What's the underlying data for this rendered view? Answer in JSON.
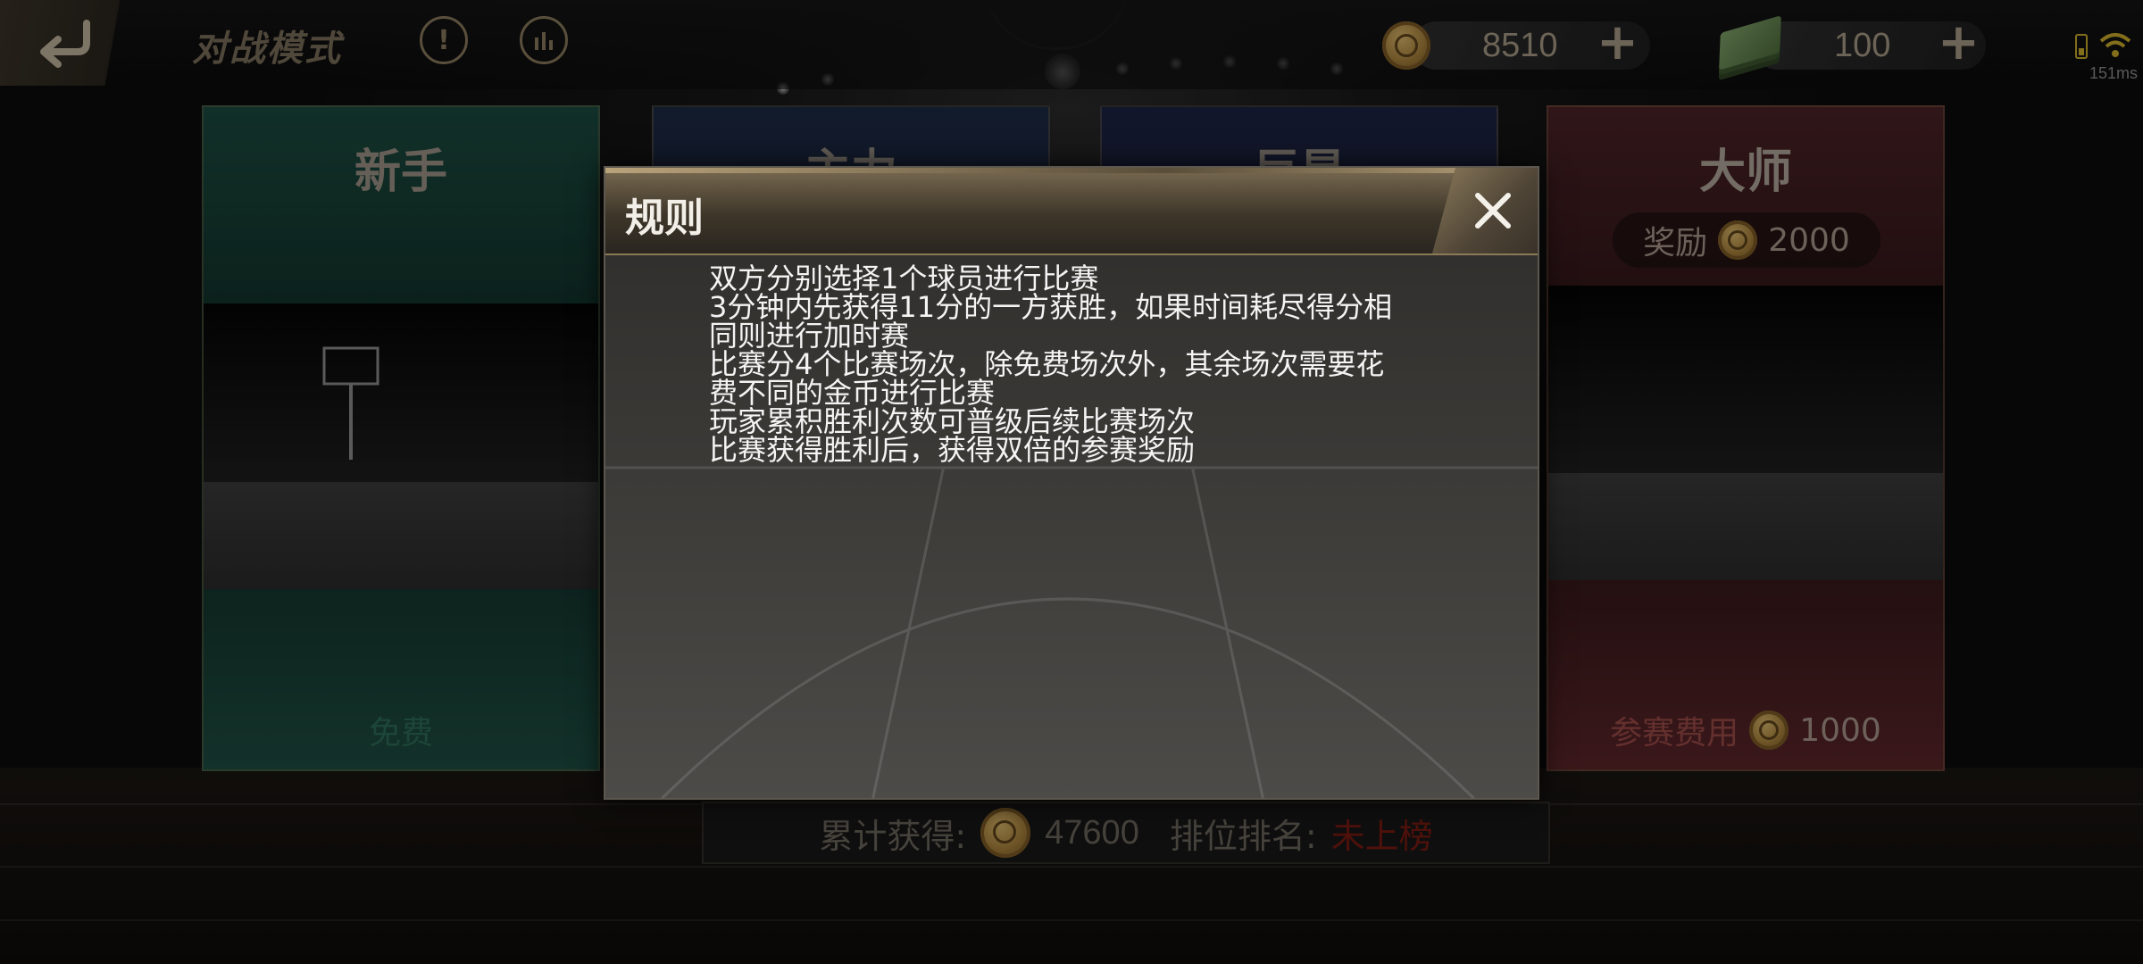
{
  "header": {
    "title": "对战模式",
    "coins": {
      "value": "8510",
      "add_label": "+"
    },
    "cash": {
      "value": "100",
      "add_label": "+"
    },
    "info_glyph": "!",
    "status": {
      "ping": "151ms"
    }
  },
  "cards": [
    {
      "title": "新手",
      "footer": "免费"
    },
    {
      "title": "主力"
    },
    {
      "title": "巨星"
    },
    {
      "title": "大师",
      "reward_label": "奖励",
      "reward_value": "2000",
      "fee_label": "参赛费用",
      "fee_value": "1000"
    }
  ],
  "stats": {
    "total_label": "累计获得:",
    "total_value": "47600",
    "rank_label": "排位排名:",
    "rank_value": "未上榜"
  },
  "dialog": {
    "title": "规则",
    "rules": [
      "双方分别选择1个球员进行比赛",
      "3分钟内先获得11分的一方获胜，如果时间耗尽得分相",
      "同则进行加时赛",
      "比赛分4个比赛场次，除免费场次外，其余场次需要花",
      "费不同的金币进行比赛",
      "玩家累积胜利次数可普级后续比赛场次",
      "比赛获得胜利后，获得双倍的参赛奖励"
    ]
  },
  "colors": {
    "accent_gold": "#8b7a58",
    "rank_red": "#7a1b12",
    "novice_green": "#1b4a3f",
    "master_red": "#4a2226"
  }
}
